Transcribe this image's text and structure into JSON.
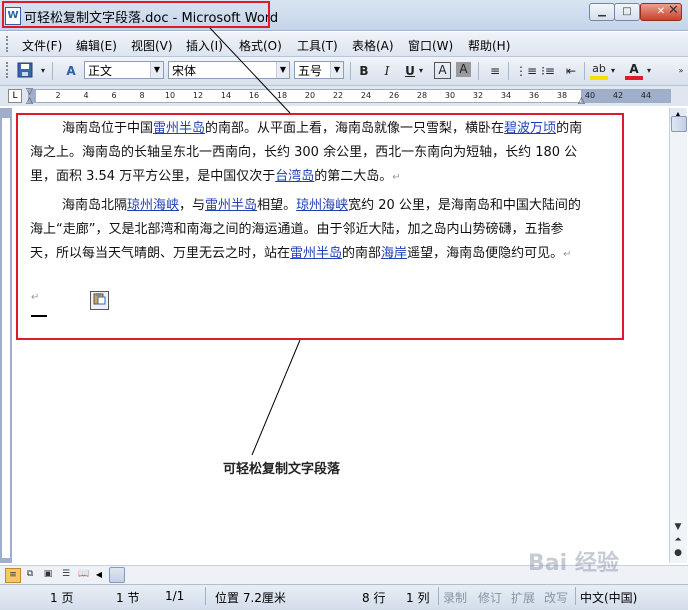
{
  "window": {
    "title": "可轻松复制文字段落.doc - Microsoft Word",
    "app_icon": "word-doc-icon",
    "controls": {
      "minimize": "▁",
      "maximize": "□",
      "close": "✕"
    }
  },
  "menu": {
    "items": [
      "文件(F)",
      "编辑(E)",
      "视图(V)",
      "插入(I)",
      "格式(O)",
      "工具(T)",
      "表格(A)",
      "窗口(W)",
      "帮助(H)"
    ],
    "close_doc": "✕"
  },
  "toolbar": {
    "style": "正文",
    "font": "宋体",
    "size": "五号",
    "style_icon": "A",
    "bold": "B",
    "italic": "I",
    "underline": "U",
    "char_border": "A",
    "char_shading": "A",
    "highlight": "ab",
    "font_color": "A",
    "highlight_color": "#f5e000",
    "font_color_value": "#e0192b"
  },
  "ruler": {
    "tab_selector": "L",
    "ticks": [
      "2",
      "4",
      "6",
      "8",
      "10",
      "12",
      "14",
      "16",
      "18",
      "20",
      "22",
      "24",
      "26",
      "28",
      "30",
      "32",
      "34",
      "36",
      "38",
      "40",
      "42",
      "44"
    ]
  },
  "document": {
    "paragraph1": [
      {
        "t": "海南岛位于中国"
      },
      {
        "t": "雷州半岛",
        "link": true
      },
      {
        "t": "的南部。从平面上看，海南岛就像一只雪梨，横卧在"
      },
      {
        "t": "碧波万顷",
        "link": true
      },
      {
        "t": "的南海之上。海南岛的长轴呈东北一西南向，长约 300 余公里，西北一东南向为短轴，长约 180 公里，面积 3.54 万平方公里，是中国仅次于"
      },
      {
        "t": "台湾岛",
        "link": true
      },
      {
        "t": "的第二大岛。"
      }
    ],
    "paragraph2": [
      {
        "t": "海南岛北隔"
      },
      {
        "t": "琼州海峡",
        "link": true
      },
      {
        "t": "，与"
      },
      {
        "t": "雷州半岛",
        "link": true
      },
      {
        "t": "相望。"
      },
      {
        "t": "琼州海峡",
        "link": true
      },
      {
        "t": "宽约 20 公里，是海南岛和中国大陆间的海上“走廊”，又是北部湾和南海之间的海运通道。由于邻近大陆，加之岛内山势磅礴，五指参天，所以每当天气晴朗、万里无云之时，站在"
      },
      {
        "t": "雷州半岛",
        "link": true
      },
      {
        "t": "的南部"
      },
      {
        "t": "海岸",
        "link": true
      },
      {
        "t": "遥望，海南岛便隐约可见。"
      }
    ],
    "paragraph_mark": "↵",
    "paste_options_icon": "paste-options-icon"
  },
  "annotation": {
    "text": "可轻松复制文字段落"
  },
  "statusbar": {
    "page": "1 页",
    "section": "1 节",
    "page_of": "1/1",
    "position": "位置 7.2厘米",
    "line": "8 行",
    "column": "1 列",
    "rec": "录制",
    "trk": "修订",
    "ext": "扩展",
    "ovr": "改写",
    "language": "中文(中国)"
  },
  "watermark": {
    "text": "Bai 经验"
  }
}
